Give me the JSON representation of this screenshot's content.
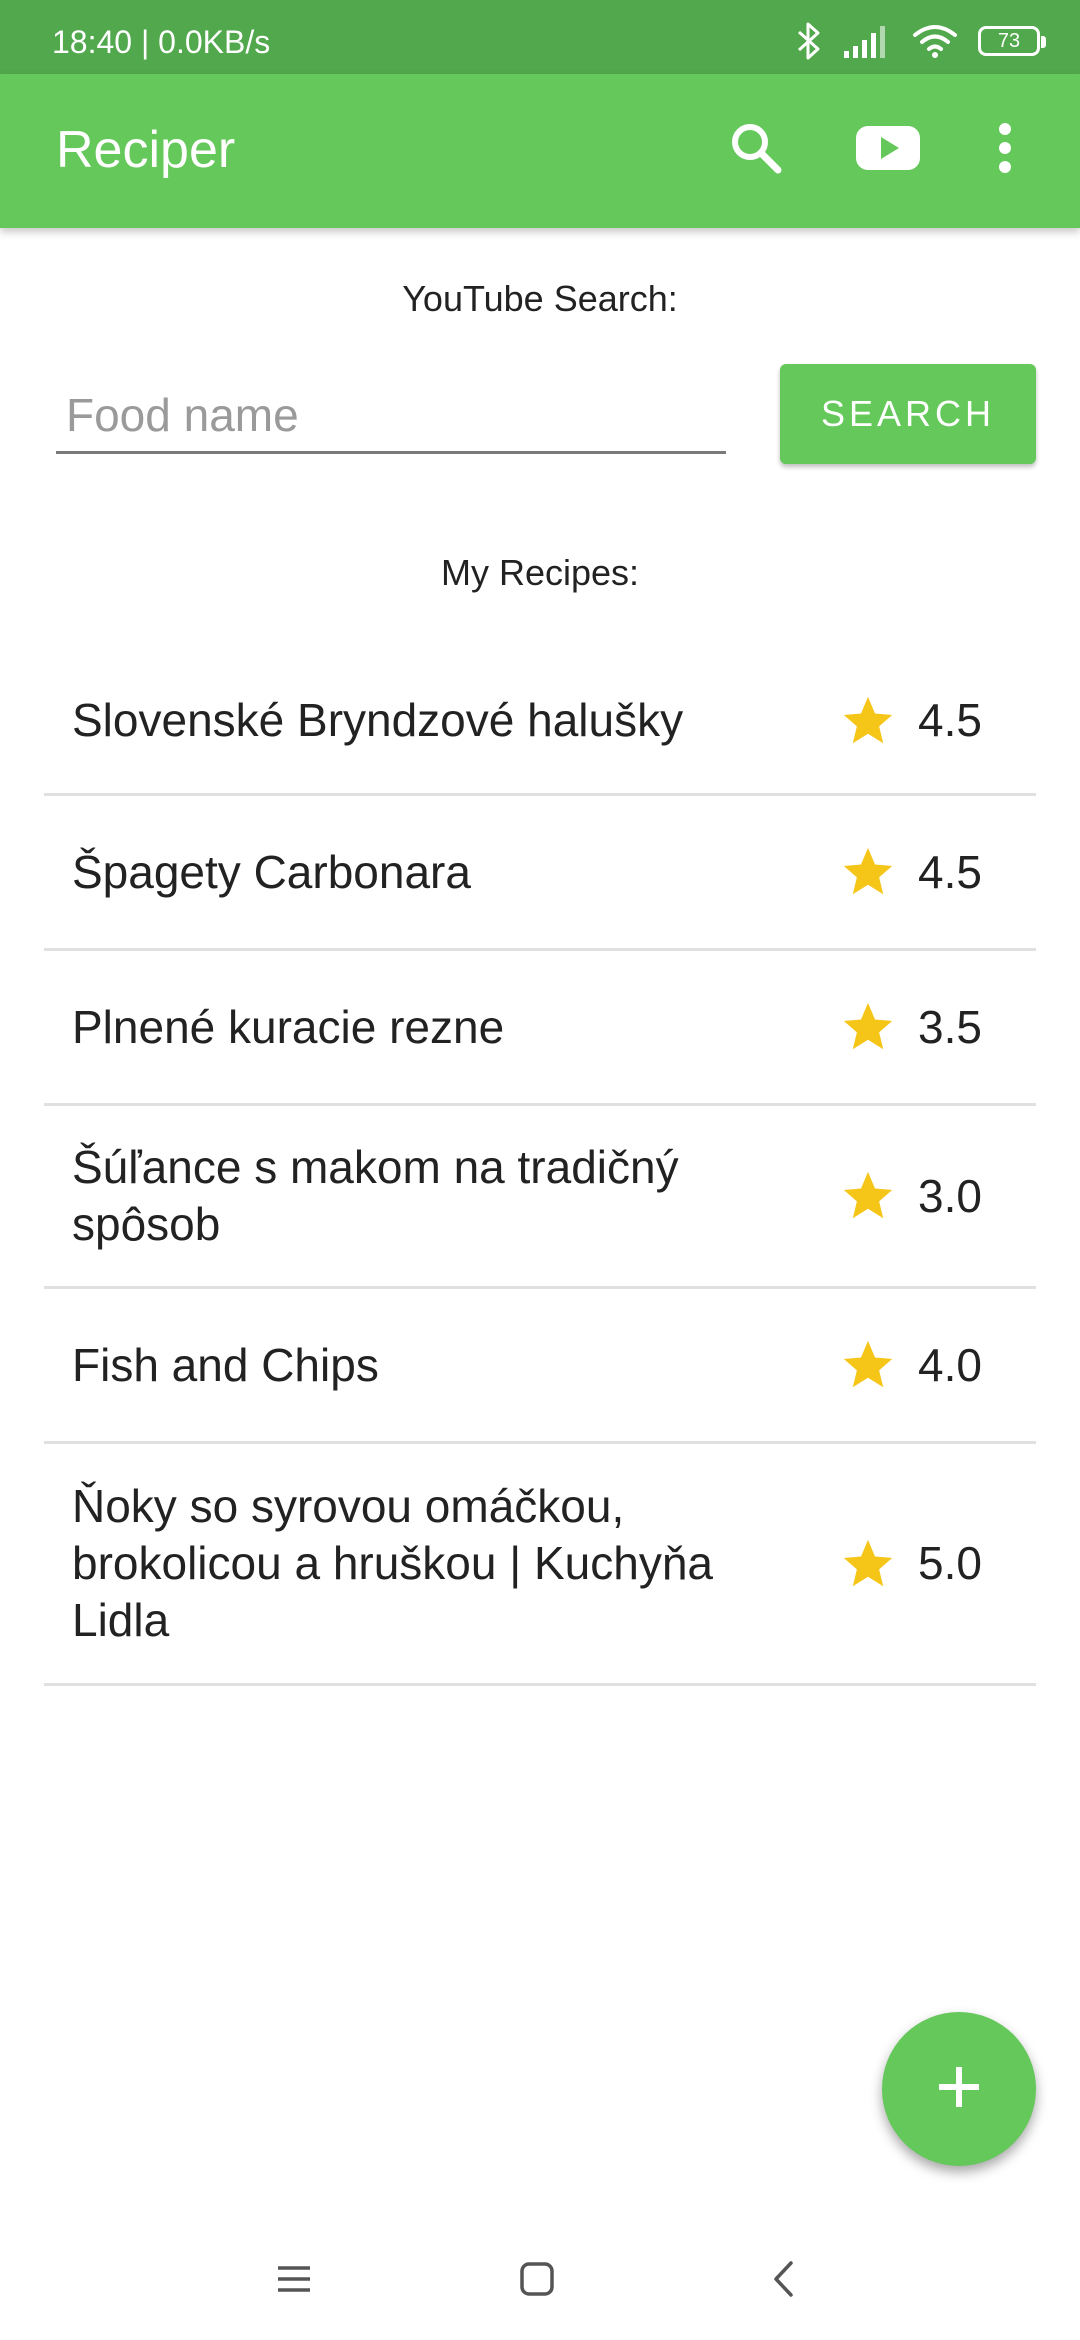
{
  "status_bar": {
    "time": "18:40 | 0.0KB/s",
    "battery": "73"
  },
  "app_bar": {
    "title": "Reciper",
    "icons": [
      "search-icon",
      "youtube-icon",
      "more-vert-icon"
    ]
  },
  "youtube_search": {
    "label": "YouTube Search:",
    "input_placeholder": "Food name",
    "input_value": "",
    "button_label": "SEARCH"
  },
  "recipes": {
    "label": "My Recipes:",
    "items": [
      {
        "name": "Slovenské Bryndzové halušky",
        "rating": "4.5"
      },
      {
        "name": "Špagety Carbonara",
        "rating": "4.5"
      },
      {
        "name": "Plnené kuracie rezne",
        "rating": "3.5"
      },
      {
        "name": "Šúľance s makom na tradičný spôsob",
        "rating": "3.0"
      },
      {
        "name": "Fish and Chips",
        "rating": "4.0"
      },
      {
        "name": "Ňoky so syrovou omáčkou, brokolicou a hruškou | Kuchyňa Lidla",
        "rating": "5.0"
      }
    ]
  },
  "fab": {
    "icon": "add-icon"
  },
  "nav_bar": {
    "icons": [
      "menu-icon",
      "home-icon",
      "back-icon"
    ]
  },
  "colors": {
    "primary": "#64c85a",
    "status_bar": "#52a84c",
    "star": "#f5c518",
    "divider": "#e0e0e0"
  }
}
